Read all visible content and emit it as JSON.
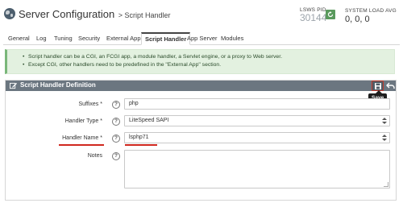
{
  "header": {
    "title": "Server Configuration",
    "subtitle": "> Script Handler",
    "pid_label": "LSWS PID",
    "pid_value": "30144",
    "load_label": "SYSTEM LOAD AVG",
    "load_value": "0, 0, 0"
  },
  "tabs": [
    {
      "label": "General",
      "active": false
    },
    {
      "label": "Log",
      "active": false
    },
    {
      "label": "Tuning",
      "active": false
    },
    {
      "label": "Security",
      "active": false
    },
    {
      "label": "External App",
      "active": false
    },
    {
      "label": "Script Handler",
      "active": true
    },
    {
      "label": "App Server",
      "active": false
    },
    {
      "label": "Modules",
      "active": false
    }
  ],
  "alert": {
    "items": [
      "Script handler can be a CGI, an FCGI app, a module handler, a Servlet engine, or a proxy to Web server.",
      "Except CGI, other handlers need to be predefined in the \"External App\" section."
    ]
  },
  "panel": {
    "title": "Script Handler Definition",
    "save_tooltip": "Save",
    "fields": [
      {
        "label": "Suffixes",
        "required": "*",
        "value": "php",
        "type": "text"
      },
      {
        "label": "Handler Type",
        "required": "*",
        "value": "LiteSpeed SAPI",
        "type": "select"
      },
      {
        "label": "Handler Name",
        "required": "*",
        "value": "lsphp71",
        "type": "select"
      },
      {
        "label": "Notes",
        "required": "",
        "value": "",
        "type": "textarea"
      }
    ],
    "help_glyph": "?"
  },
  "colors": {
    "panel_header": "#6b7680",
    "alert_bg": "#e3f1e0",
    "alert_border": "#7ab77a",
    "highlight": "#d0281f",
    "restart_button": "#5a9a5d"
  },
  "icons": {
    "globe": "globe-icon",
    "restart": "restart-icon",
    "edit": "edit-icon",
    "save": "save-icon",
    "back": "back-icon",
    "help": "help-icon"
  }
}
